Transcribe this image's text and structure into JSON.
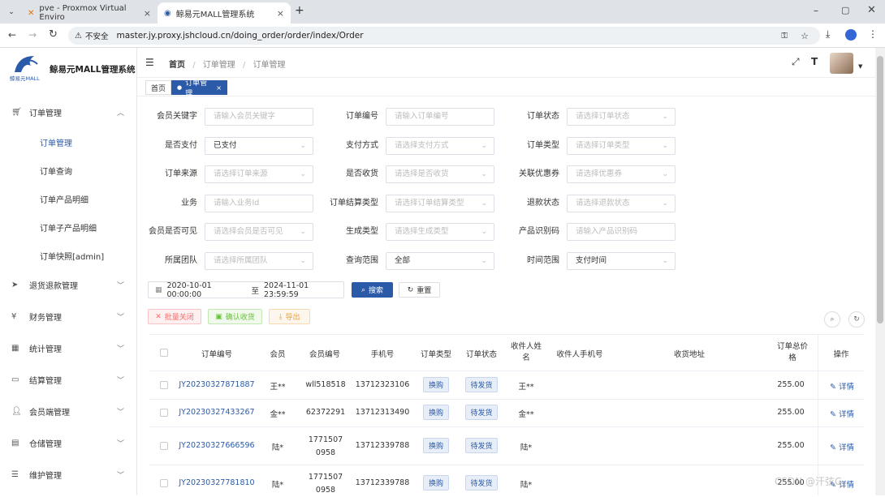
{
  "browser": {
    "tabs": [
      {
        "title": "pve - Proxmox Virtual Enviro"
      },
      {
        "title": "鲸易元MALL管理系统"
      }
    ],
    "security_label": "不安全",
    "url": "master.jy.proxy.jshcloud.cn/doing_order/order/index/Order"
  },
  "sidebar": {
    "logo_title": "鲸易元MALL管理系统",
    "logo_sub": "鲸易元MALL",
    "menu": [
      {
        "label": "订单管理",
        "icon": "cart-icon"
      },
      {
        "label": "退货退款管理",
        "icon": "send-icon"
      },
      {
        "label": "财务管理",
        "icon": "yen-icon"
      },
      {
        "label": "统计管理",
        "icon": "stats-icon"
      },
      {
        "label": "结算管理",
        "icon": "monitor-icon"
      },
      {
        "label": "会员端管理",
        "icon": "user-icon"
      },
      {
        "label": "仓储管理",
        "icon": "warehouse-icon"
      },
      {
        "label": "维护管理",
        "icon": "sliders-icon"
      }
    ],
    "submenu": [
      "订单管理",
      "订单查询",
      "订单产品明细",
      "订单子产品明细",
      "订单快照[admin]"
    ]
  },
  "header": {
    "breadcrumb": [
      "首页",
      "订单管理",
      "订单管理"
    ],
    "tags": [
      "首页",
      "订单管理"
    ]
  },
  "filters": {
    "row1": [
      {
        "label": "会员关键字",
        "value": "请输入会员关键字",
        "filled": false,
        "select": false
      },
      {
        "label": "订单编号",
        "value": "请输入订单编号",
        "filled": false,
        "select": false
      },
      {
        "label": "订单状态",
        "value": "请选择订单状态",
        "filled": false,
        "select": true
      }
    ],
    "row2": [
      {
        "label": "是否支付",
        "value": "已支付",
        "filled": true,
        "select": true
      },
      {
        "label": "支付方式",
        "value": "请选择支付方式",
        "filled": false,
        "select": true
      },
      {
        "label": "订单类型",
        "value": "请选择订单类型",
        "filled": false,
        "select": true
      }
    ],
    "row3": [
      {
        "label": "订单来源",
        "value": "请选择订单来源",
        "filled": false,
        "select": true
      },
      {
        "label": "是否收货",
        "value": "请选择是否收货",
        "filled": false,
        "select": true
      },
      {
        "label": "关联优惠券",
        "value": "请选择优惠券",
        "filled": false,
        "select": true
      }
    ],
    "row4": [
      {
        "label": "业务",
        "value": "请输入业务Id",
        "filled": false,
        "select": false
      },
      {
        "label": "订单结算类型",
        "value": "请选择订单结算类型",
        "filled": false,
        "select": true
      },
      {
        "label": "退款状态",
        "value": "请选择退款状态",
        "filled": false,
        "select": true
      }
    ],
    "row5": [
      {
        "label": "会员是否可见",
        "value": "请选择会员是否可见",
        "filled": false,
        "select": true
      },
      {
        "label": "生成类型",
        "value": "请选择生成类型",
        "filled": false,
        "select": true
      },
      {
        "label": "产品识别码",
        "value": "请输入产品识别码",
        "filled": false,
        "select": false
      }
    ],
    "row6": [
      {
        "label": "所属团队",
        "value": "请选择所属团队",
        "filled": false,
        "select": true
      },
      {
        "label": "查询范围",
        "value": "全部",
        "filled": true,
        "select": true
      },
      {
        "label": "时间范围",
        "value": "支付时间",
        "filled": true,
        "select": true
      }
    ],
    "date_start": "2020-10-01 00:00:00",
    "date_sep": "至",
    "date_end": "2024-11-01 23:59:59",
    "search_label": "搜索",
    "reset_label": "重置"
  },
  "actions": {
    "batch_close": "批量关闭",
    "confirm_receipt": "确认收货",
    "export": "导出"
  },
  "table": {
    "headers": [
      "订单编号",
      "会员",
      "会员编号",
      "手机号",
      "订单类型",
      "订单状态",
      "收件人姓名",
      "收件人手机号",
      "收货地址",
      "订单总价格",
      "操作"
    ],
    "rows": [
      {
        "order_no": "JY20230327871887",
        "member": "王**",
        "member_no": "wll518518",
        "phone": "13712323106",
        "type": "换购",
        "status": "待发货",
        "recipient": "王**",
        "total": "255.00",
        "op": "详情"
      },
      {
        "order_no": "JY20230327433267",
        "member": "金**",
        "member_no": "62372291",
        "phone": "13712313490",
        "type": "换购",
        "status": "待发货",
        "recipient": "金**",
        "total": "255.00",
        "op": "详情"
      },
      {
        "order_no": "JY20230327666596",
        "member": "陆*",
        "member_no": "17715070958",
        "phone": "13712339788",
        "type": "换购",
        "status": "待发货",
        "recipient": "陆*",
        "total": "255.00",
        "op": "详情"
      },
      {
        "order_no": "JY20230327781810",
        "member": "陆*",
        "member_no": "17715070958",
        "phone": "13712339788",
        "type": "换购",
        "status": "待发货",
        "recipient": "陆*",
        "total": "255.00",
        "op": "详情"
      }
    ]
  },
  "watermark": "CSDN @汗弦G",
  "colors": {
    "primary": "#2b5aa8",
    "danger": "#f56c6c",
    "success": "#67c23a",
    "warning": "#e6a23c"
  }
}
